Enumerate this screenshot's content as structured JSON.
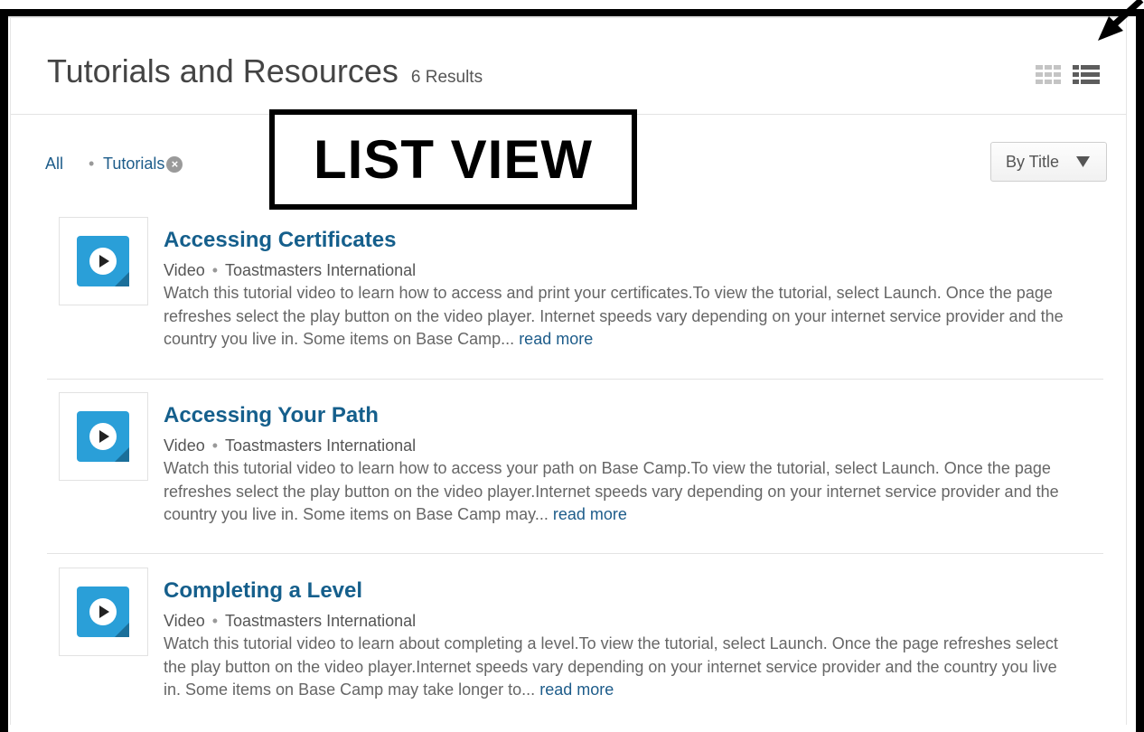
{
  "header": {
    "title": "Tutorials and Resources",
    "results": "6 Results"
  },
  "view_toggle": {
    "grid_icon": "grid-view-icon",
    "list_icon": "list-view-icon",
    "active": "list"
  },
  "filters": {
    "all_label": "All",
    "separator": "•",
    "active_tag": "Tutorials",
    "remove_icon": "remove-filter-icon"
  },
  "annotation": {
    "label": "LIST VIEW"
  },
  "sort": {
    "label": "By Title",
    "icon": "caret-down-icon"
  },
  "colors": {
    "link": "#1d5c8a",
    "title": "#155f8c",
    "video_icon": "#2a9fd8",
    "annotation_border": "#000000"
  },
  "items": [
    {
      "title": "Accessing Certificates",
      "type": "Video",
      "separator": "•",
      "provider": "Toastmasters International",
      "description": "Watch this tutorial video to learn how to access and print your certificates.To view the tutorial, select Launch. Once the page refreshes select the play button on the video player. Internet speeds vary depending on your internet service provider and the country you live in. Some items on Base Camp...",
      "read_more": "read more",
      "icon": "video-play-icon"
    },
    {
      "title": "Accessing Your Path",
      "type": "Video",
      "separator": "•",
      "provider": "Toastmasters International",
      "description": "Watch this tutorial video to learn how to access your path on Base Camp.To view the tutorial, select Launch. Once the page refreshes select the play button on the video player.Internet speeds vary depending on your internet service provider and the country you live in. Some items on Base Camp may...",
      "read_more": "read more",
      "icon": "video-play-icon"
    },
    {
      "title": "Completing a Level",
      "type": "Video",
      "separator": "•",
      "provider": "Toastmasters International",
      "description": "Watch this tutorial video to learn about completing a level.To view the tutorial, select Launch. Once the page refreshes select the play button on the video player.Internet speeds vary depending on your internet service provider and the country you live in. Some items on Base Camp may take longer to...",
      "read_more": "read more",
      "icon": "video-play-icon"
    }
  ]
}
